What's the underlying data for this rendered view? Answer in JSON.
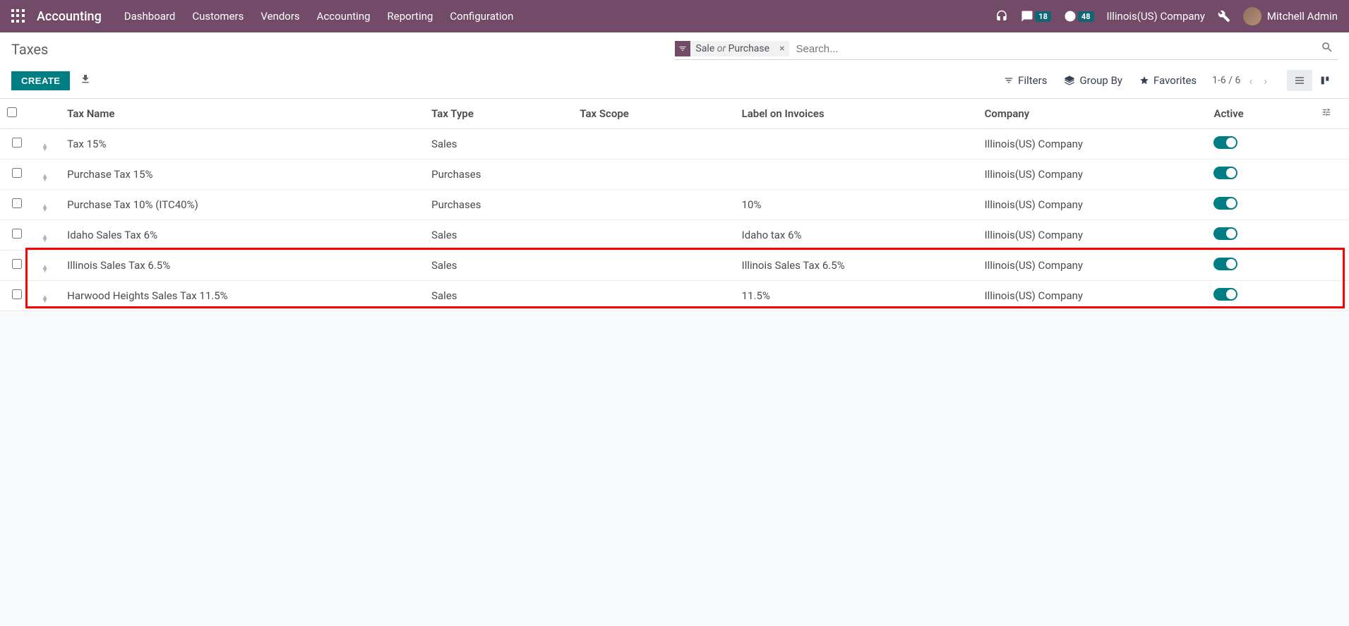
{
  "navbar": {
    "app_title": "Accounting",
    "menu": [
      "Dashboard",
      "Customers",
      "Vendors",
      "Accounting",
      "Reporting",
      "Configuration"
    ],
    "messages_badge": "18",
    "activities_badge": "48",
    "company": "Illinois(US) Company",
    "user_name": "Mitchell Admin"
  },
  "control": {
    "title": "Taxes",
    "create_label": "CREATE",
    "facet_part1": "Sale",
    "facet_or": "or",
    "facet_part2": "Purchase",
    "search_placeholder": "Search...",
    "filters_label": "Filters",
    "groupby_label": "Group By",
    "favorites_label": "Favorites",
    "pager_text": "1-6 / 6"
  },
  "columns": {
    "name": "Tax Name",
    "type": "Tax Type",
    "scope": "Tax Scope",
    "label": "Label on Invoices",
    "company": "Company",
    "active": "Active"
  },
  "rows": [
    {
      "name": "Tax 15%",
      "type": "Sales",
      "scope": "",
      "label": "",
      "company": "Illinois(US) Company"
    },
    {
      "name": "Purchase Tax 15%",
      "type": "Purchases",
      "scope": "",
      "label": "",
      "company": "Illinois(US) Company"
    },
    {
      "name": "Purchase Tax 10% (ITC40%)",
      "type": "Purchases",
      "scope": "",
      "label": "10%",
      "company": "Illinois(US) Company"
    },
    {
      "name": "Idaho Sales Tax 6%",
      "type": "Sales",
      "scope": "",
      "label": "Idaho tax 6%",
      "company": "Illinois(US) Company"
    },
    {
      "name": "Illinois Sales Tax 6.5%",
      "type": "Sales",
      "scope": "",
      "label": "Illinois Sales Tax 6.5%",
      "company": "Illinois(US) Company"
    },
    {
      "name": "Harwood Heights Sales Tax 11.5%",
      "type": "Sales",
      "scope": "",
      "label": "11.5%",
      "company": "Illinois(US) Company"
    }
  ]
}
